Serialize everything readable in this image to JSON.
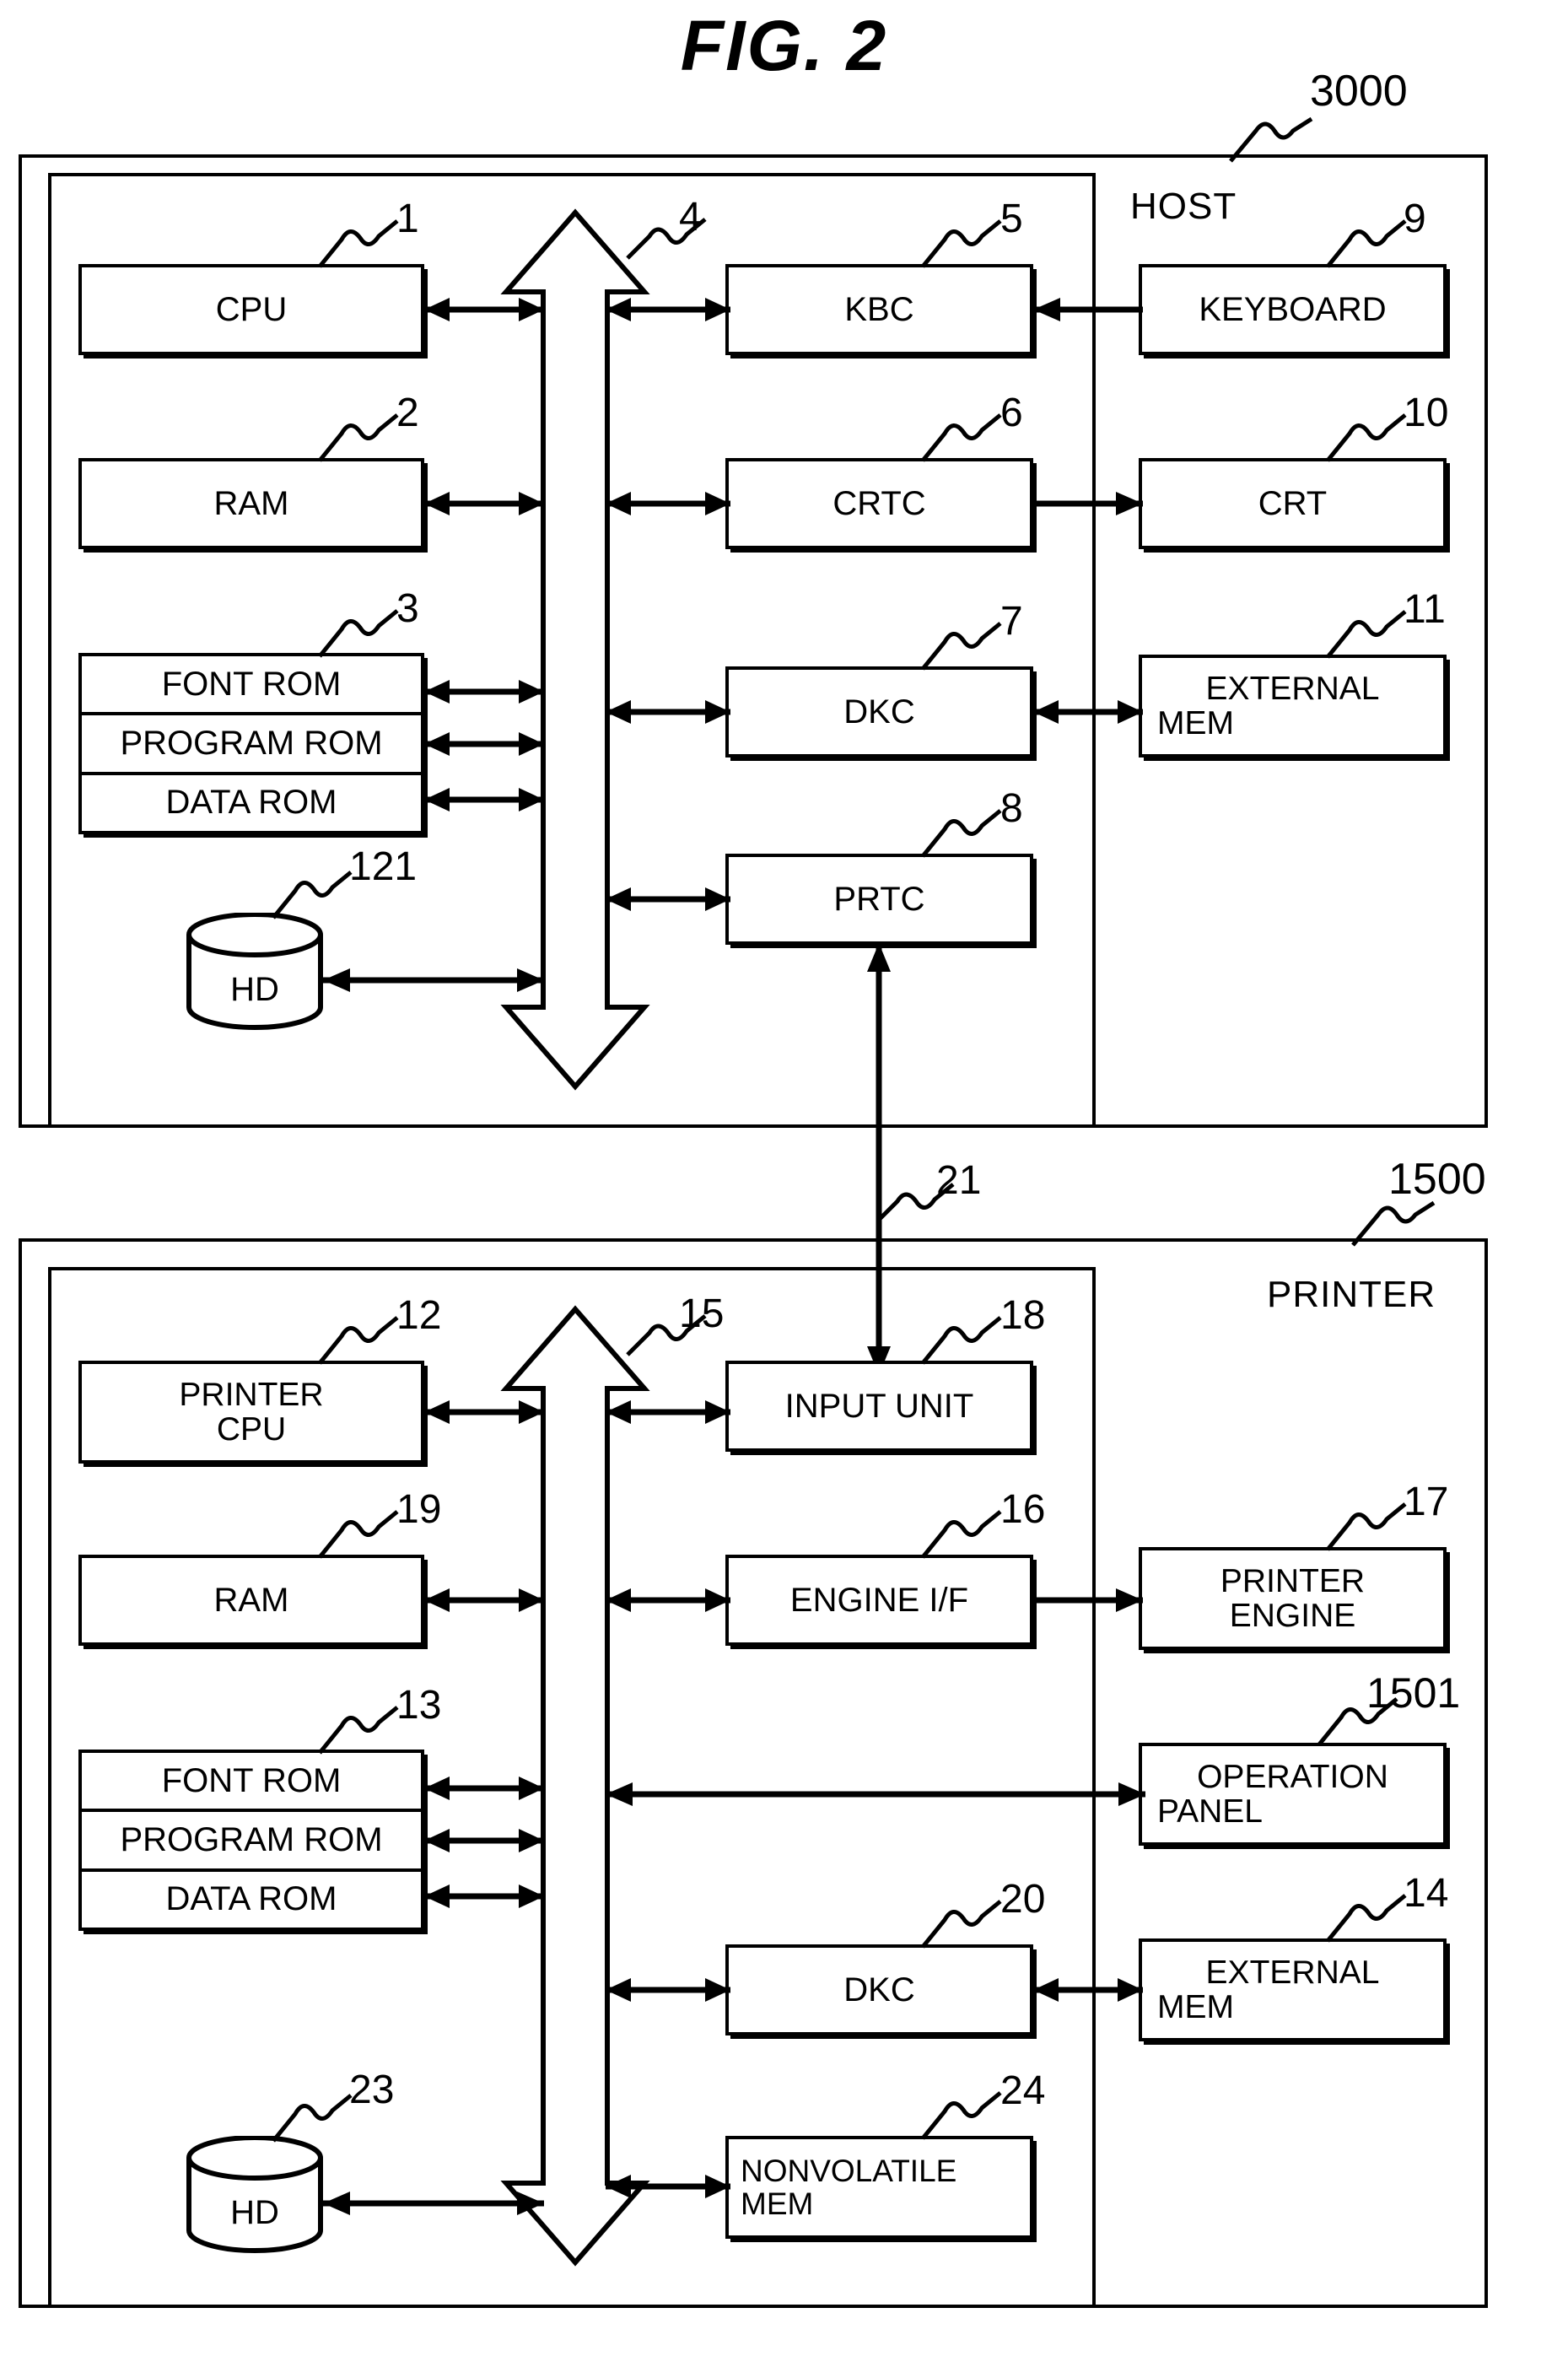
{
  "figure": {
    "title": "FIG. 2"
  },
  "host": {
    "system_label": "HOST",
    "system_ref": "3000",
    "blocks": [
      {
        "id": "cpu",
        "label": "CPU",
        "ref": "1"
      },
      {
        "id": "ram",
        "label": "RAM",
        "ref": "2"
      },
      {
        "id": "rom",
        "label": "",
        "ref": "3",
        "cells": [
          "FONT ROM",
          "PROGRAM ROM",
          "DATA ROM"
        ]
      },
      {
        "id": "hd",
        "label": "HD",
        "ref": "121"
      },
      {
        "id": "bus",
        "label": "",
        "ref": "4"
      },
      {
        "id": "kbc",
        "label": "KBC",
        "ref": "5"
      },
      {
        "id": "crtc",
        "label": "CRTC",
        "ref": "6"
      },
      {
        "id": "dkc",
        "label": "DKC",
        "ref": "7"
      },
      {
        "id": "prtc",
        "label": "PRTC",
        "ref": "8"
      },
      {
        "id": "keyboard",
        "label": "KEYBOARD",
        "ref": "9"
      },
      {
        "id": "crt",
        "label": "CRT",
        "ref": "10"
      },
      {
        "id": "extmem",
        "label": "EXTERNAL\nMEM",
        "label_line1": "EXTERNAL",
        "label_line2": "MEM",
        "ref": "11"
      }
    ]
  },
  "link": {
    "ref": "21"
  },
  "printer": {
    "system_label": "PRINTER",
    "system_ref": "1500",
    "blocks": [
      {
        "id": "printer_cpu",
        "label_line1": "PRINTER",
        "label_line2": "CPU",
        "ref": "12"
      },
      {
        "id": "ram",
        "label": "RAM",
        "ref": "19"
      },
      {
        "id": "rom",
        "label": "",
        "ref": "13",
        "cells": [
          "FONT ROM",
          "PROGRAM ROM",
          "DATA ROM"
        ]
      },
      {
        "id": "hd",
        "label": "HD",
        "ref": "23"
      },
      {
        "id": "bus",
        "label": "",
        "ref": "15"
      },
      {
        "id": "input_unit",
        "label": "INPUT UNIT",
        "ref": "18"
      },
      {
        "id": "engine_if",
        "label": "ENGINE I/F",
        "ref": "16"
      },
      {
        "id": "dkc",
        "label": "DKC",
        "ref": "20"
      },
      {
        "id": "nvmem",
        "label_line1": "NONVOLATILE",
        "label_line2": "MEM",
        "ref": "24"
      },
      {
        "id": "printer_engine",
        "label_line1": "PRINTER",
        "label_line2": "ENGINE",
        "ref": "17"
      },
      {
        "id": "op_panel",
        "label_line1": "OPERATION",
        "label_line2": "PANEL",
        "ref": "1501"
      },
      {
        "id": "extmem",
        "label_line1": "EXTERNAL",
        "label_line2": "MEM",
        "ref": "14"
      }
    ]
  },
  "colors": {
    "ink": "#000000",
    "paper": "#ffffff"
  }
}
